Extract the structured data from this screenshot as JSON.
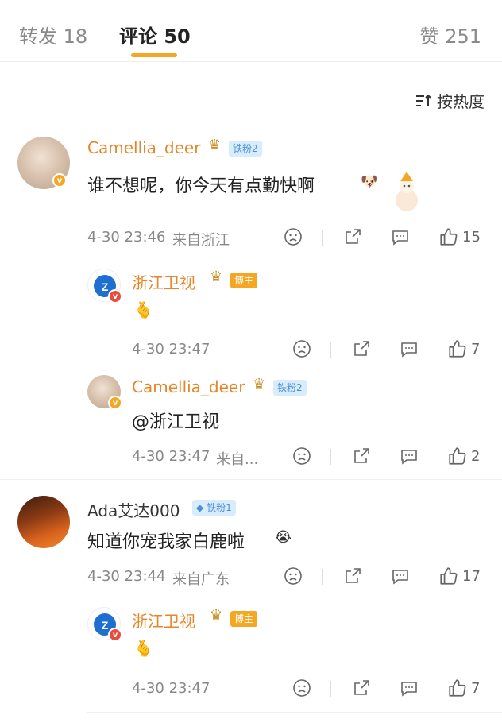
{
  "tabs": [
    {
      "label": "转发",
      "count": "18"
    },
    {
      "label": "评论",
      "count": "50"
    },
    {
      "label": "赞",
      "count": "251"
    }
  ],
  "sort_label": "按热度",
  "comments": [
    {
      "user": "Camellia_deer",
      "fan_badge": "铁粉2",
      "text": "谁不想呢，你今天有点勤快啊",
      "time": "4-30 23:46",
      "location": "来自浙江",
      "likes": "15",
      "replies": [
        {
          "user": "浙江卫视",
          "owner_badge": "博主",
          "text": "",
          "time": "4-30 23:47",
          "likes": "7"
        },
        {
          "user": "Camellia_deer",
          "fan_badge": "铁粉2",
          "text": "@浙江卫视",
          "time": "4-30 23:47",
          "location": "来自...",
          "likes": "2"
        }
      ]
    },
    {
      "user": "Ada艾达000",
      "fan_badge": "铁粉1",
      "text": "知道你宠我家白鹿啦",
      "time": "4-30 23:44",
      "location": "来自广东",
      "likes": "17",
      "replies": [
        {
          "user": "浙江卫视",
          "owner_badge": "博主",
          "text": "",
          "time": "4-30 23:47",
          "likes": "7"
        }
      ]
    }
  ],
  "icons": {
    "sort": "sort-icon",
    "dislike": "sad-face-icon",
    "share": "share-icon",
    "comment": "comment-icon",
    "like": "thumbs-up-icon",
    "crown": "crown-icon",
    "heart_hand": "finger-heart-icon"
  },
  "colors": {
    "accent": "#f5a623",
    "username": "#e6862a",
    "fan_badge_bg": "#d9ecfb",
    "fan_badge_text": "#4a90d9",
    "verified": "#f5a623",
    "verified_red": "#e94b3c"
  }
}
